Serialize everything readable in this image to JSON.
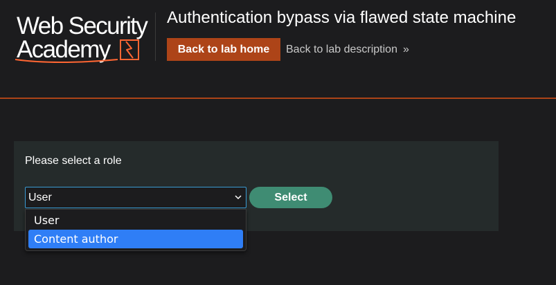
{
  "header": {
    "logo": {
      "line1": "Web Security",
      "line2": "Academy"
    },
    "lab_title": "Authentication bypass via flawed state machine",
    "back_to_lab_home": "Back to lab home",
    "back_to_lab_description": "Back to lab description",
    "chevron_glyph": "»"
  },
  "form": {
    "label": "Please select a role",
    "selected_value": "User",
    "submit_label": "Select",
    "options": [
      "User",
      "Content author"
    ],
    "highlighted_option": "Content author"
  },
  "colors": {
    "background": "#1c1c1e",
    "accent": "#ad4418",
    "panel": "#252b2b",
    "select_button": "#3f8c73",
    "focus_border": "#3a9bd3",
    "highlight": "#2f7ef6"
  }
}
